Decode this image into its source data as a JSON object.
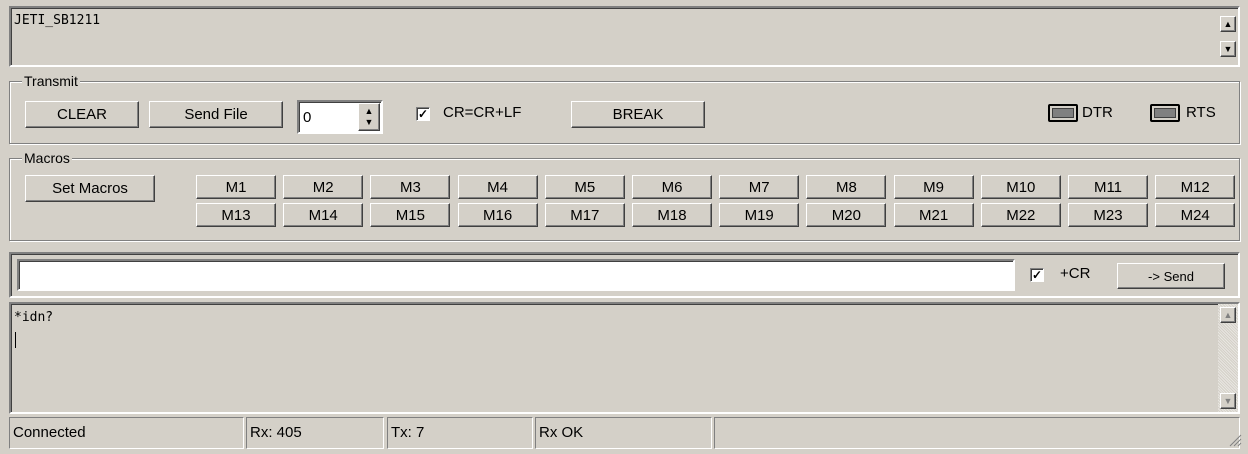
{
  "device_box": {
    "text": "JETI_SB1211"
  },
  "transmit": {
    "label": "Transmit",
    "clear_label": "CLEAR",
    "send_file_label": "Send File",
    "delay_value": "0",
    "crlf_label": "CR=CR+LF",
    "crlf_checked": true,
    "break_label": "BREAK",
    "dtr_label": "DTR",
    "rts_label": "RTS"
  },
  "macros": {
    "label": "Macros",
    "set_macros_label": "Set Macros",
    "row1": [
      "M1",
      "M2",
      "M3",
      "M4",
      "M5",
      "M6",
      "M7",
      "M8",
      "M9",
      "M10",
      "M11",
      "M12"
    ],
    "row2": [
      "M13",
      "M14",
      "M15",
      "M16",
      "M17",
      "M18",
      "M19",
      "M20",
      "M21",
      "M22",
      "M23",
      "M24"
    ]
  },
  "send_bar": {
    "input_value": "",
    "cr_label": "+CR",
    "cr_checked": true,
    "send_label": "-> Send"
  },
  "terminal": {
    "lines": [
      "*idn?"
    ]
  },
  "status": {
    "connection": "Connected",
    "rx": "Rx: 405",
    "tx": "Tx: 7",
    "rx_status": "Rx OK"
  }
}
